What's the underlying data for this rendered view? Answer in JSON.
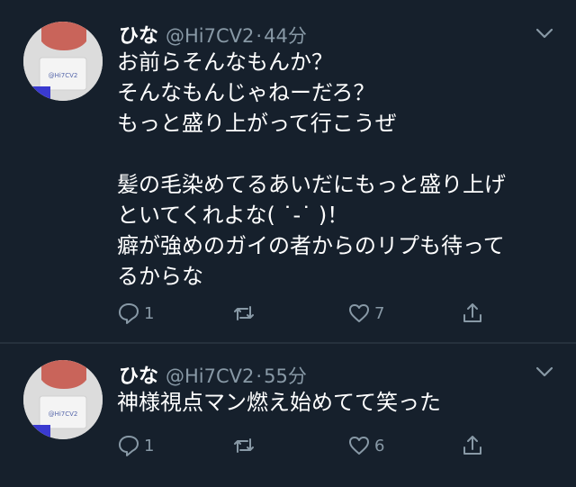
{
  "tweets": [
    {
      "name": "ひな",
      "handle": "@Hi7CV2",
      "separator": "·",
      "time": "44分",
      "text": "お前らそんなもんか？\nそんなもんじゃねーだろ？\nもっと盛り上がって行こうぜ\n\n髪の毛染めてるあいだにもっと盛り上げ\nといてくれよな( ˙-˙ )！\n癖が強めのガイの者からのリプも待って\nるからな",
      "replies": "1",
      "retweets": "",
      "likes": "7"
    },
    {
      "name": "ひな",
      "handle": "@Hi7CV2",
      "separator": "·",
      "time": "55分",
      "text": "神様視点マン燃え始めてて笑った",
      "replies": "1",
      "retweets": "",
      "likes": "6"
    }
  ],
  "avatar_card_text": "@Hi7CV2",
  "icons": [
    "chevron-down-icon",
    "reply-icon",
    "retweet-icon",
    "like-icon",
    "share-icon"
  ],
  "colors": {
    "background": "#16202c",
    "text": "#ffffff",
    "muted": "#8899a6",
    "divider": "#26313d"
  }
}
